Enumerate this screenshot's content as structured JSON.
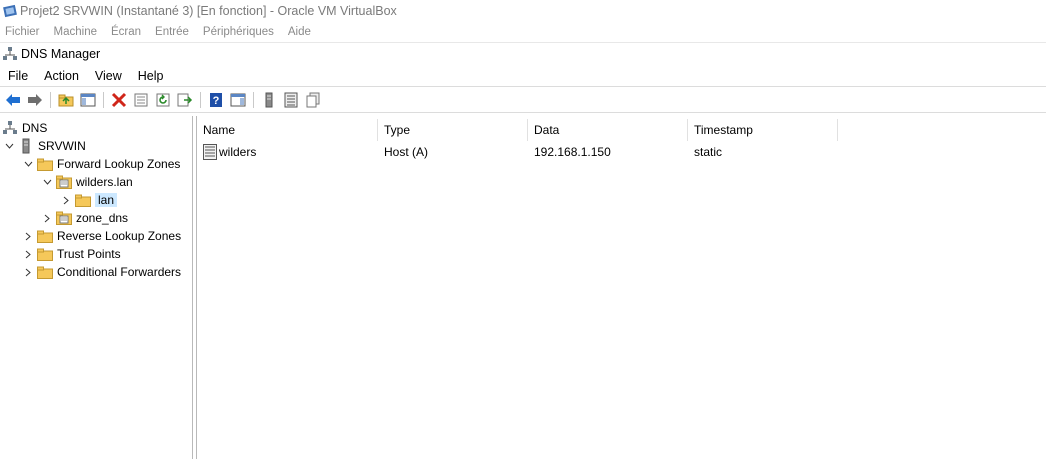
{
  "vbox": {
    "title": "Projet2 SRVWIN (Instantané 3) [En fonction] - Oracle VM VirtualBox",
    "menu": [
      "Fichier",
      "Machine",
      "Écran",
      "Entrée",
      "Périphériques",
      "Aide"
    ]
  },
  "mmc": {
    "title": "DNS Manager",
    "menu": [
      "File",
      "Action",
      "View",
      "Help"
    ]
  },
  "tree": {
    "root": "DNS",
    "server": "SRVWIN",
    "forward": "Forward Lookup Zones",
    "zone1": "wilders.lan",
    "zone1_child": "lan",
    "zone2": "zone_dns",
    "reverse": "Reverse Lookup Zones",
    "trust": "Trust Points",
    "cond": "Conditional Forwarders"
  },
  "list": {
    "columns": [
      "Name",
      "Type",
      "Data",
      "Timestamp"
    ],
    "rows": [
      {
        "name": "wilders",
        "type": "Host (A)",
        "data": "192.168.1.150",
        "timestamp": "static"
      }
    ]
  },
  "icons": {
    "back": "back-arrow-icon",
    "forward": "forward-arrow-icon",
    "delete": "delete-icon",
    "help": "help-icon"
  },
  "colors": {
    "selection": "#cce8ff",
    "folder": "#f5c85a",
    "arrow_blue": "#1f6fd1",
    "delete_red": "#d0261a"
  }
}
